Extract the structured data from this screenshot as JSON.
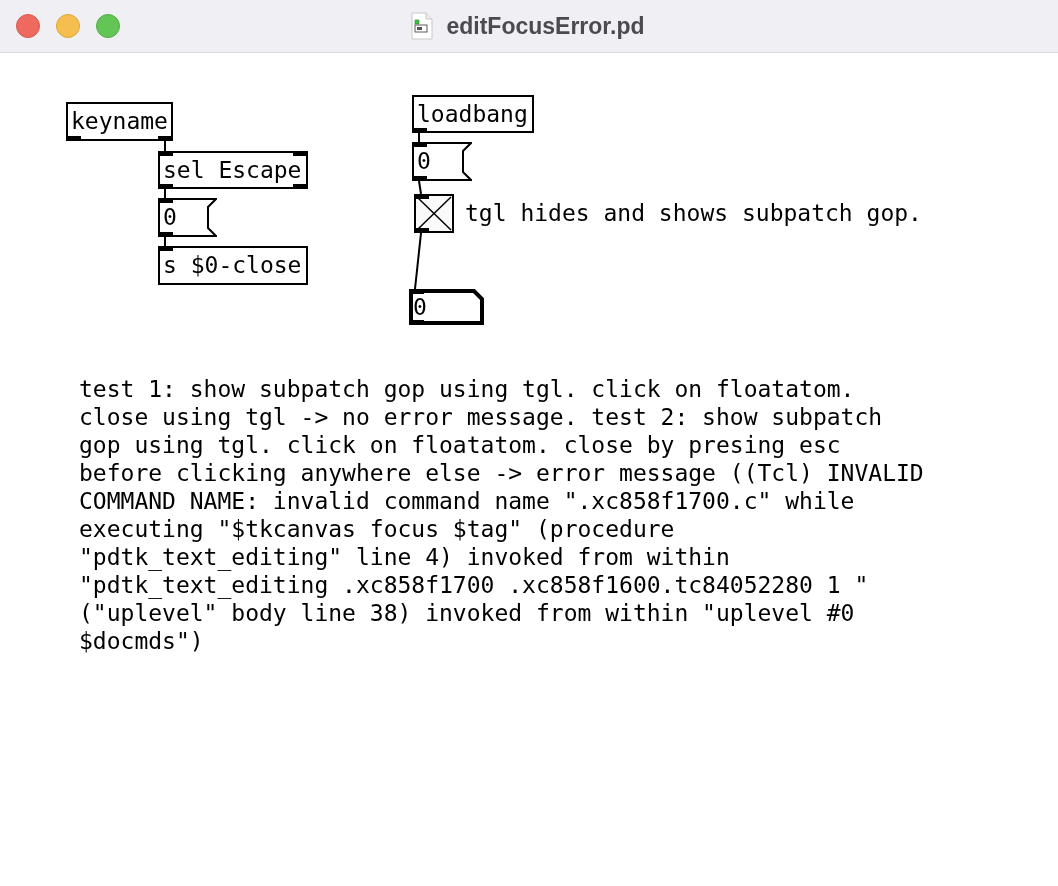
{
  "window": {
    "title": "editFocusError.pd"
  },
  "canvas": {
    "boxes": [
      {
        "kind": "object",
        "text": "keyname"
      },
      {
        "kind": "object",
        "text": "sel Escape"
      },
      {
        "kind": "message",
        "text": "0"
      },
      {
        "kind": "object",
        "text": "s $0-close"
      },
      {
        "kind": "object",
        "text": "loadbang"
      },
      {
        "kind": "message",
        "text": "0"
      },
      {
        "kind": "toggle",
        "checked": true
      },
      {
        "kind": "comment",
        "text": "tgl hides and shows subpatch gop."
      },
      {
        "kind": "floatatom",
        "text": "0",
        "active": true
      },
      {
        "kind": "comment",
        "text": "test 1: show subpatch gop using tgl. click on floatatom. close using tgl -> no error message. test 2: show subpatch gop using tgl. click on floatatom. close by presing esc before clicking anywhere else -> error message ((Tcl) INVALID COMMAND NAME: invalid command name \".xc858f1700.c\" while executing \"$tkcanvas focus $tag\" (procedure \"pdtk_text_editing\" line 4) invoked from within \"pdtk_text_editing .xc858f1700 .xc858f1600.tc84052280 1 \" (\"uplevel\" body line 38) invoked from within \"uplevel #0 $docmds\")"
      }
    ]
  }
}
